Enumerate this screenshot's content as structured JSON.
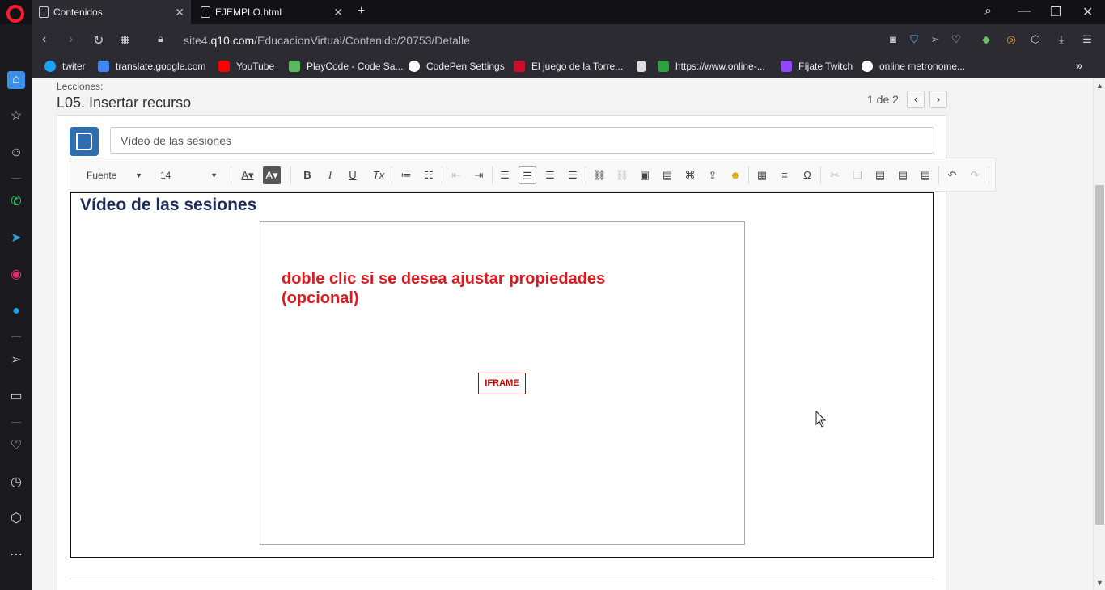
{
  "browser": {
    "tabs": [
      {
        "title": "Contenidos",
        "active": true
      },
      {
        "title": "EJEMPLO.html",
        "active": false
      }
    ],
    "url_prefix": "site4.",
    "url_domain": "q10.com",
    "url_path": "/EducacionVirtual/Contenido/20753/Detalle",
    "bookmarks": [
      "twiter",
      "translate.google.com",
      "YouTube",
      "PlayCode - Code Sa...",
      "CodePen Settings",
      "El juego de la Torre...",
      "https://www.online-...",
      "Fíjate Twitch",
      "online metronome..."
    ],
    "bookmark_more": "»"
  },
  "page": {
    "lecciones_label": "Lecciones:",
    "lesson_title": "L05. Insertar recurso",
    "pager": "1 de 2",
    "title_input_value": "Vídeo de las sesiones",
    "toolbar": {
      "font_label": "Fuente",
      "size_label": "14"
    },
    "editor": {
      "heading": "Vídeo de las sesiones",
      "iframe_note": "doble clic si se desea ajustar propiedades (opcional)",
      "iframe_badge": "IFRAME"
    }
  },
  "colors": {
    "accent_blue": "#2f6db1",
    "heading_navy": "#1c2d5a",
    "note_red": "#e0191e"
  }
}
